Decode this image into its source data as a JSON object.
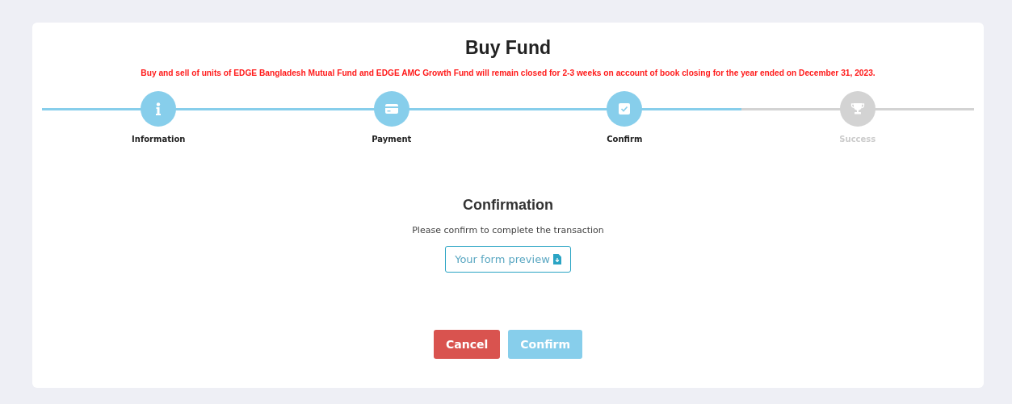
{
  "title": "Buy Fund",
  "notice": "Buy and sell of units of EDGE Bangladesh Mutual Fund and EDGE AMC Growth Fund will remain closed for 2-3 weeks on account of book closing for the year ended on December 31, 2023.",
  "steps": [
    {
      "label": "Information",
      "kind": "info",
      "done": true
    },
    {
      "label": "Payment",
      "kind": "card",
      "done": true
    },
    {
      "label": "Confirm",
      "kind": "check",
      "done": true
    },
    {
      "label": "Success",
      "kind": "trophy",
      "done": false
    }
  ],
  "section": {
    "heading": "Confirmation",
    "text": "Please confirm to complete the transaction",
    "preview_button": "Your form preview"
  },
  "buttons": [
    {
      "label": "Cancel",
      "kind": "cancel",
      "disabled": false
    },
    {
      "label": "Confirm",
      "kind": "confirm",
      "disabled": true
    }
  ]
}
